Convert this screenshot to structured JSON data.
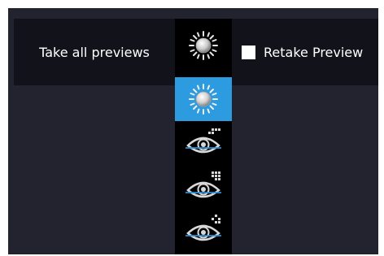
{
  "toolbar": {
    "take_all_previews_label": "Take all previews",
    "retake_preview_label": "Retake Preview",
    "retake_preview_checked": false,
    "mode_dropdown": {
      "selected_icon": "brightness-sun-icon",
      "caret_icon": "caret-up-icon"
    }
  },
  "mode_list": {
    "items": [
      {
        "icon": "brightness-sun-icon",
        "selected": true
      },
      {
        "icon": "eye-grid-3-dots-icon",
        "selected": false
      },
      {
        "icon": "eye-grid-6-dots-icon",
        "selected": false
      },
      {
        "icon": "eye-grid-sparse-icon",
        "selected": false
      }
    ]
  },
  "colors": {
    "background": "#22232f",
    "toolbar_background": "#12131a",
    "selection_blue": "#2c9be0",
    "caret_blue": "#29a8e0",
    "eye_line_blue": "#2a8fd6"
  }
}
